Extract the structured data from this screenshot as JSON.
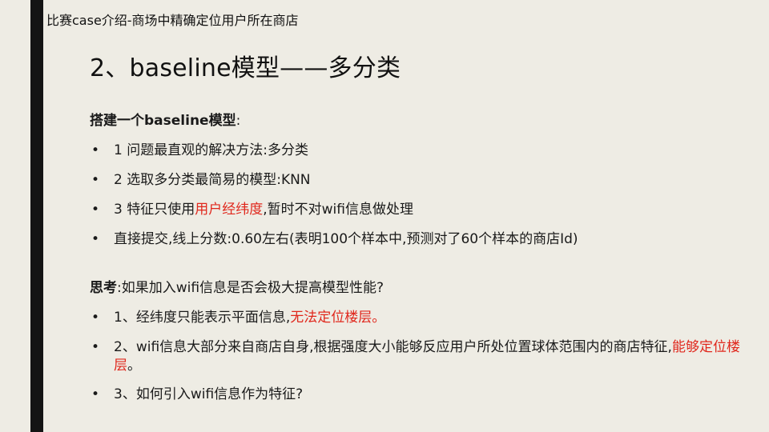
{
  "header": {
    "text": "比赛case介绍-商场中精确定位用户所在商店"
  },
  "title": "2、baseline模型——多分类",
  "section1": {
    "heading_bold": "搭建一个baseline模型",
    "heading_suffix": ":",
    "items": [
      {
        "pre": "1 问题最直观的解决方法:多分类",
        "highlight": "",
        "post": ""
      },
      {
        "pre": "2 选取多分类最简易的模型:KNN",
        "highlight": "",
        "post": ""
      },
      {
        "pre": "3 特征只使用",
        "highlight": "用户经纬度",
        "post": ",暂时不对wifi信息做处理"
      },
      {
        "pre": "直接提交,线上分数:0.60左右(表明100个样本中,预测对了60个样本的商店Id)",
        "highlight": "",
        "post": ""
      }
    ]
  },
  "section2": {
    "heading_bold": "思考",
    "heading_suffix": ":如果加入wifi信息是否会极大提高模型性能?",
    "items": [
      {
        "pre": "1、经纬度只能表示平面信息,",
        "highlight": "无法定位楼层。",
        "post": ""
      },
      {
        "pre": "2、wifi信息大部分来自商店自身,根据强度大小能够反应用户所处位置球体范围内的商店特征,",
        "highlight": "能够定位楼层",
        "post": "。"
      },
      {
        "pre": "3、如何引入wifi信息作为特征?",
        "highlight": "",
        "post": ""
      }
    ]
  },
  "bullet_char": "•",
  "colors": {
    "background": "#eeece4",
    "bar": "#141414",
    "highlight": "#e0271c"
  }
}
